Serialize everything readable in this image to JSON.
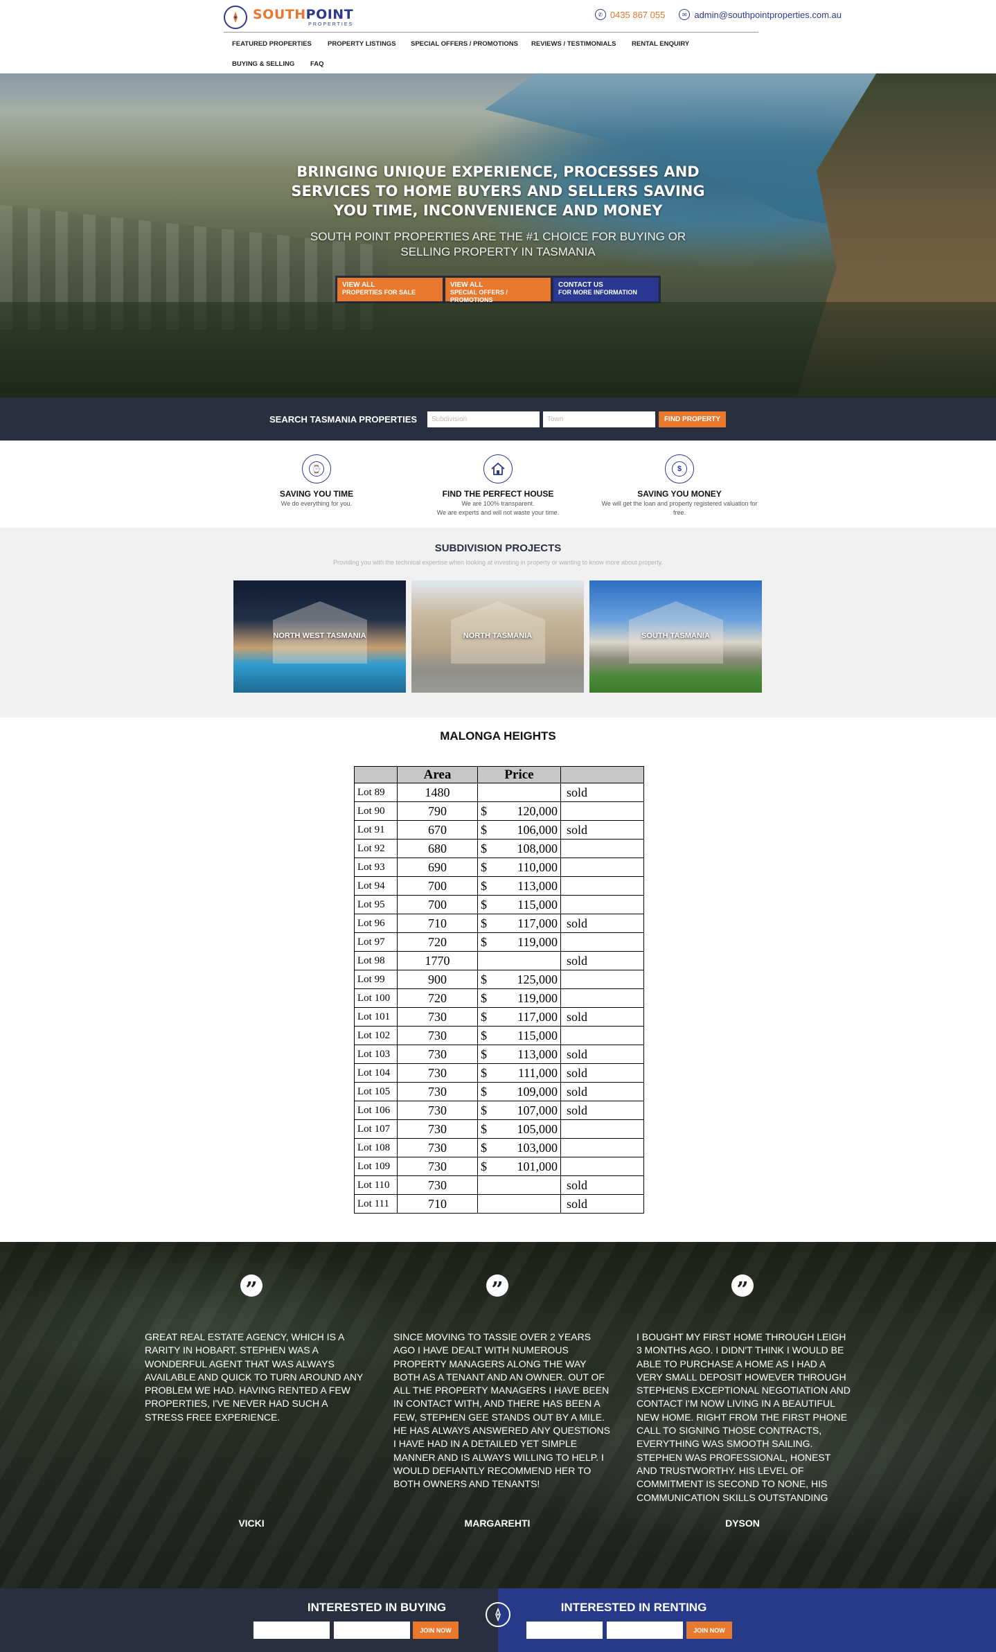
{
  "header": {
    "logo_south": "SOUTH",
    "logo_point": "POINT",
    "logo_sub": "PROPERTIES",
    "phone": "0435 867 055",
    "email": "admin@southpointproperties.com.au",
    "nav": [
      "FEATURED PROPERTIES",
      "PROPERTY LISTINGS",
      "SPECIAL OFFERS / PROMOTIONS",
      "REVIEWS / TESTIMONIALS",
      "RENTAL ENQUIRY",
      "BUYING & SELLING",
      "FAQ"
    ]
  },
  "hero": {
    "heading": "BRINGING UNIQUE EXPERIENCE, PROCESSES AND SERVICES TO HOME BUYERS AND SELLERS SAVING YOU TIME, INCONVENIENCE AND MONEY",
    "subheading": "SOUTH POINT PROPERTIES ARE THE #1 CHOICE FOR BUYING OR SELLING PROPERTY IN TASMANIA",
    "buttons": [
      {
        "line1": "VIEW ALL",
        "line2": "PROPERTIES FOR SALE",
        "color": "#e8782e"
      },
      {
        "line1": "VIEW ALL",
        "line2": "SPECIAL OFFERS / PROMOTIONS",
        "color": "#e8782e"
      },
      {
        "line1": "CONTACT US",
        "line2": "FOR MORE INFORMATION",
        "color": "#2a3891"
      }
    ]
  },
  "search": {
    "label": "SEARCH TASMANIA PROPERTIES",
    "subdivision_placeholder": "Subdivision",
    "town_placeholder": "Town",
    "button": "FIND PROPERTY"
  },
  "features": [
    {
      "icon": "clock-icon",
      "title": "SAVING YOU TIME",
      "desc1": "We do everything for you.",
      "desc2": ""
    },
    {
      "icon": "house-icon",
      "title": "FIND THE PERFECT HOUSE",
      "desc1": "We are 100% transparent.",
      "desc2": "We are experts and will not waste your time."
    },
    {
      "icon": "money-icon",
      "title": "SAVING YOU MONEY",
      "desc1": "We will get the loan and property registered valuation for",
      "desc2": "free."
    }
  ],
  "subdivisions": {
    "title": "SUBDIVISION PROJECTS",
    "subtitle": "Providing you with the technical expertise when looking at investing in property or wanting to know more about property.",
    "cards": [
      "NORTH WEST TASMANIA",
      "NORTH TASMANIA",
      "SOUTH TASMANIA"
    ]
  },
  "lots": {
    "title": "MALONGA HEIGHTS",
    "headers": [
      "",
      "Area",
      "Price",
      ""
    ],
    "rows": [
      {
        "lot": "Lot 89",
        "area": "1480",
        "currency": "",
        "price": "",
        "status": "sold"
      },
      {
        "lot": "Lot 90",
        "area": "790",
        "currency": "$",
        "price": "120,000",
        "status": ""
      },
      {
        "lot": "Lot 91",
        "area": "670",
        "currency": "$",
        "price": "106,000",
        "status": "sold"
      },
      {
        "lot": "Lot 92",
        "area": "680",
        "currency": "$",
        "price": "108,000",
        "status": ""
      },
      {
        "lot": "Lot 93",
        "area": "690",
        "currency": "$",
        "price": "110,000",
        "status": ""
      },
      {
        "lot": "Lot 94",
        "area": "700",
        "currency": "$",
        "price": "113,000",
        "status": ""
      },
      {
        "lot": "Lot 95",
        "area": "700",
        "currency": "$",
        "price": "115,000",
        "status": ""
      },
      {
        "lot": "Lot 96",
        "area": "710",
        "currency": "$",
        "price": "117,000",
        "status": "sold"
      },
      {
        "lot": "Lot 97",
        "area": "720",
        "currency": "$",
        "price": "119,000",
        "status": ""
      },
      {
        "lot": "Lot 98",
        "area": "1770",
        "currency": "",
        "price": "",
        "status": "sold"
      },
      {
        "lot": "Lot 99",
        "area": "900",
        "currency": "$",
        "price": "125,000",
        "status": ""
      },
      {
        "lot": "Lot 100",
        "area": "720",
        "currency": "$",
        "price": "119,000",
        "status": ""
      },
      {
        "lot": "Lot 101",
        "area": "730",
        "currency": "$",
        "price": "117,000",
        "status": "sold"
      },
      {
        "lot": "Lot 102",
        "area": "730",
        "currency": "$",
        "price": "115,000",
        "status": ""
      },
      {
        "lot": "Lot 103",
        "area": "730",
        "currency": "$",
        "price": "113,000",
        "status": "sold"
      },
      {
        "lot": "Lot 104",
        "area": "730",
        "currency": "$",
        "price": "111,000",
        "status": "sold"
      },
      {
        "lot": "Lot 105",
        "area": "730",
        "currency": "$",
        "price": "109,000",
        "status": "sold"
      },
      {
        "lot": "Lot 106",
        "area": "730",
        "currency": "$",
        "price": "107,000",
        "status": "sold"
      },
      {
        "lot": "Lot 107",
        "area": "730",
        "currency": "$",
        "price": "105,000",
        "status": ""
      },
      {
        "lot": "Lot 108",
        "area": "730",
        "currency": "$",
        "price": "103,000",
        "status": ""
      },
      {
        "lot": "Lot 109",
        "area": "730",
        "currency": "$",
        "price": "101,000",
        "status": ""
      },
      {
        "lot": "Lot 110",
        "area": "730",
        "currency": "",
        "price": "",
        "status": "sold"
      },
      {
        "lot": "Lot 111",
        "area": "710",
        "currency": "",
        "price": "",
        "status": "sold"
      }
    ]
  },
  "testimonials": [
    {
      "text": "GREAT REAL ESTATE AGENCY, WHICH IS A RARITY IN HOBART. STEPHEN WAS A WONDERFUL AGENT THAT WAS ALWAYS AVAILABLE AND QUICK TO TURN AROUND ANY PROBLEM WE HAD. HAVING RENTED A FEW PROPERTIES, I'VE NEVER HAD SUCH A STRESS FREE EXPERIENCE.",
      "name": "VICKI"
    },
    {
      "text": "SINCE MOVING TO TASSIE OVER 2 YEARS AGO I HAVE DEALT WITH NUMEROUS PROPERTY MANAGERS ALONG THE WAY BOTH AS A TENANT AND AN OWNER. OUT OF ALL THE PROPERTY MANAGERS I HAVE BEEN IN CONTACT WITH, AND THERE HAS BEEN A FEW, STEPHEN GEE STANDS OUT BY A MILE. HE HAS ALWAYS ANSWERED ANY QUESTIONS I HAVE HAD IN A DETAILED YET SIMPLE MANNER AND IS ALWAYS WILLING TO HELP. I WOULD DEFIANTLY RECOMMEND HER TO BOTH OWNERS AND TENANTS!",
      "name": "MARGAREHTI"
    },
    {
      "text": "I BOUGHT MY FIRST HOME THROUGH LEIGH 3 MONTHS AGO. I DIDN'T THINK I WOULD BE ABLE TO PURCHASE A HOME AS I HAD A VERY SMALL DEPOSIT HOWEVER THROUGH STEPHENS EXCEPTIONAL NEGOTIATION AND CONTACT I'M NOW LIVING IN A BEAUTIFUL NEW HOME.  RIGHT FROM THE FIRST PHONE CALL TO SIGNING THOSE CONTRACTS, EVERYTHING WAS SMOOTH SAILING. STEPHEN WAS PROFESSIONAL, HONEST AND TRUSTWORTHY. HIS LEVEL OF COMMITMENT IS SECOND TO NONE, HIS COMMUNICATION SKILLS OUTSTANDING",
      "name": "DYSON"
    }
  ],
  "footer": {
    "buying_title": "INTERESTED IN BUYING",
    "renting_title": "INTERESTED IN RENTING",
    "join_label": "JOIN NOW"
  },
  "colors": {
    "accent": "#e8782e",
    "brand": "#2d3a8c",
    "dark": "#2a2f40"
  }
}
